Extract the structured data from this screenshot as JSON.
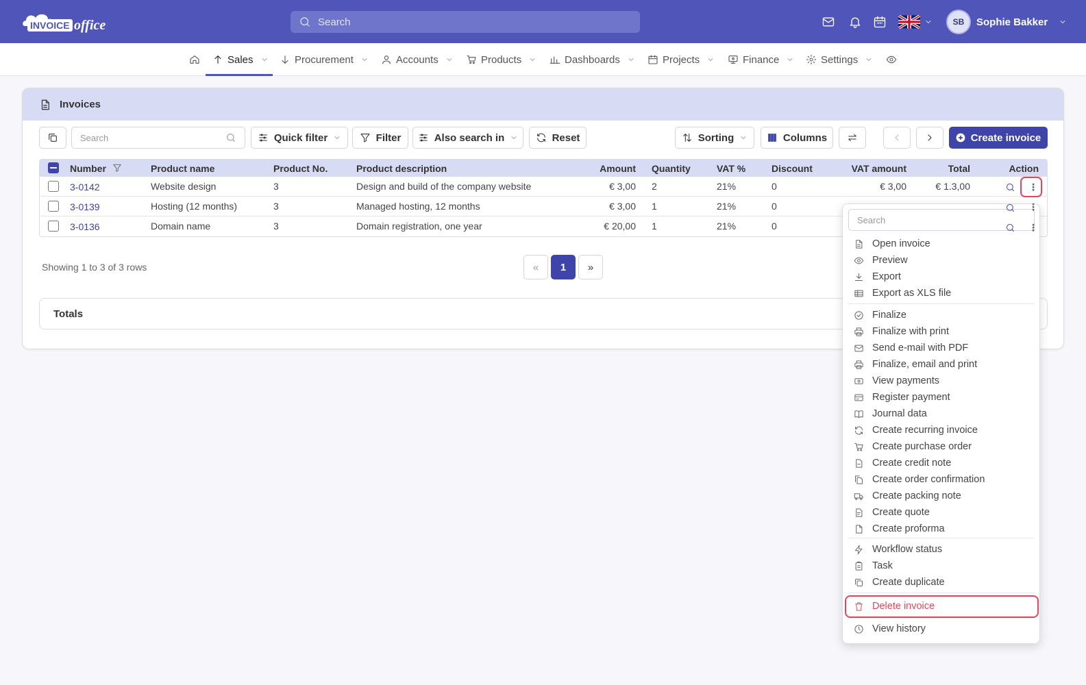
{
  "app": {
    "logo_text": "INVOICEoffice",
    "search_placeholder": "Search",
    "user": {
      "initials": "SB",
      "name": "Sophie Bakker"
    }
  },
  "nav": {
    "items": [
      {
        "label": "Sales",
        "icon": "arrow-up-icon"
      },
      {
        "label": "Procurement",
        "icon": "arrow-down-icon"
      },
      {
        "label": "Accounts",
        "icon": "user-icon"
      },
      {
        "label": "Products",
        "icon": "cart-icon"
      },
      {
        "label": "Dashboards",
        "icon": "chart-icon"
      },
      {
        "label": "Projects",
        "icon": "calendar-icon"
      },
      {
        "label": "Finance",
        "icon": "monitor-icon"
      },
      {
        "label": "Settings",
        "icon": "gear-icon"
      }
    ],
    "active": "Sales"
  },
  "card": {
    "title": "Invoices",
    "toolbar": {
      "search_placeholder": "Search",
      "quick_filter": "Quick filter",
      "filter": "Filter",
      "also_search_in": "Also search in",
      "reset": "Reset",
      "sorting": "Sorting",
      "columns": "Columns",
      "create_invoice": "Create invoice"
    },
    "table": {
      "headers": {
        "number": "Number",
        "product_name": "Product name",
        "product_no": "Product No.",
        "product_description": "Product description",
        "amount": "Amount",
        "quantity": "Quantity",
        "vat_pct": "VAT %",
        "discount": "Discount",
        "vat_amount": "VAT amount",
        "total": "Total",
        "action": "Action"
      },
      "rows": [
        {
          "number": "3-0142",
          "product_name": "Website design",
          "product_no": "3",
          "description": "Design and build of the company website",
          "amount": "€ 3,00",
          "quantity": "2",
          "vat": "21%",
          "discount": "0",
          "vat_amount": "€ 3,00",
          "total": "€ 1.3,00"
        },
        {
          "number": "3-0139",
          "product_name": "Hosting (12 months)",
          "product_no": "3",
          "description": "Managed hosting, 12 months",
          "amount": "€ 3,00",
          "quantity": "1",
          "vat": "21%",
          "discount": "0"
        },
        {
          "number": "3-0136",
          "product_name": "Domain name",
          "product_no": "3",
          "description": "Domain registration, one year",
          "amount": "€ 20,00",
          "quantity": "1",
          "vat": "21%",
          "discount": "0"
        }
      ]
    },
    "pagination": {
      "showing": "Showing 1 to 3 of 3 rows",
      "prev": "«",
      "current": "1",
      "next": "»"
    },
    "totals_label": "Totals"
  },
  "menu": {
    "search_placeholder": "Search",
    "items": [
      "Open invoice",
      "Preview",
      "Export",
      "Export as XLS file",
      "Finalize",
      "Finalize with print",
      "Send e-mail with PDF",
      "Finalize, email and print",
      "View payments",
      "Register payment",
      "Journal data",
      "Create recurring invoice",
      "Create purchase order",
      "Create credit note",
      "Create order confirmation",
      "Create packing note",
      "Create quote",
      "Create proforma",
      "Workflow status",
      "Task",
      "Create duplicate",
      "Delete invoice",
      "View history"
    ]
  },
  "colors": {
    "brand": "#4f55b9",
    "primary": "#3e44a8",
    "danger": "#e0485a",
    "header_bg": "#d8dbf4"
  }
}
